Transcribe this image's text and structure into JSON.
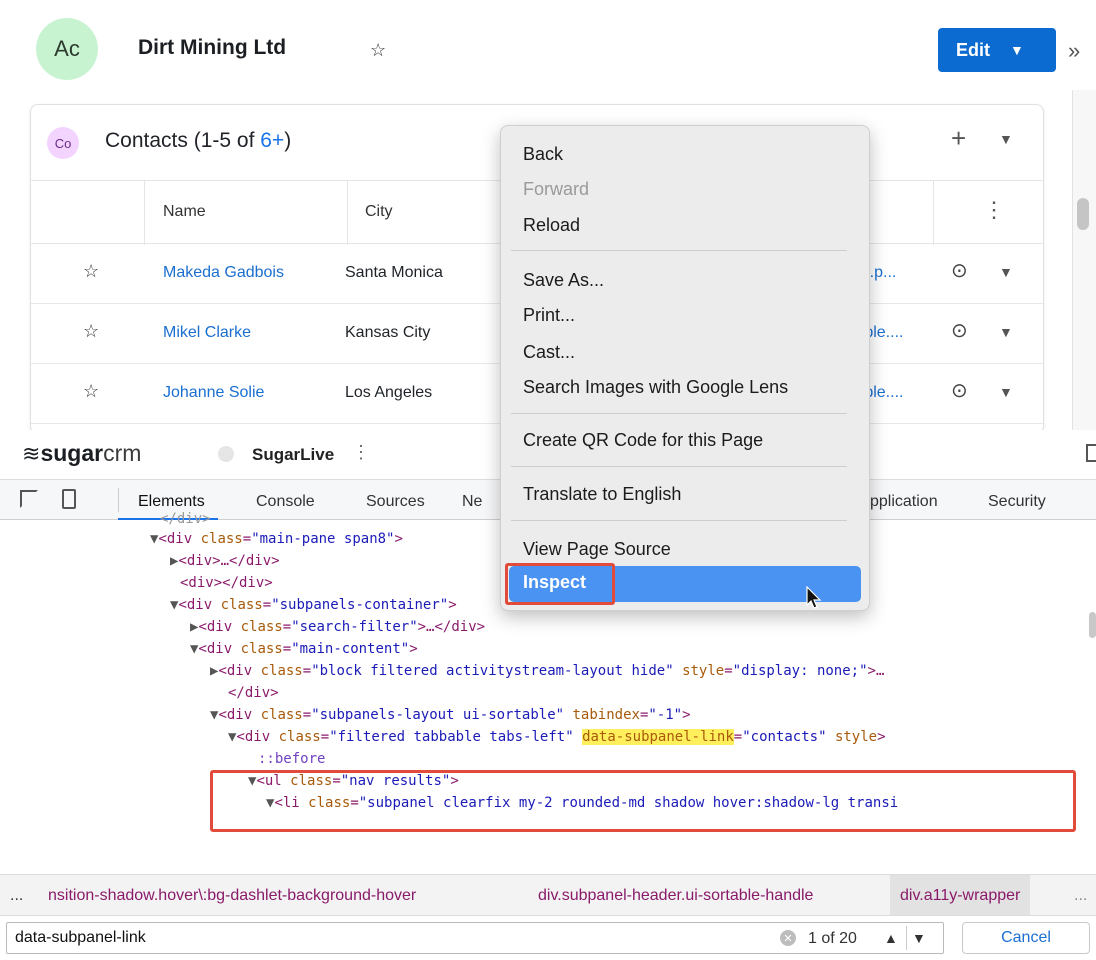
{
  "record": {
    "avatar": "Ac",
    "title": "Dirt Mining Ltd",
    "favorite_icon": "star-outline-icon",
    "edit_label": "Edit"
  },
  "contacts_panel": {
    "badge": "Co",
    "title_prefix": "Contacts (1-5 of ",
    "title_count": "6+",
    "title_suffix": ")",
    "columns": [
      "Name",
      "City"
    ],
    "rows": [
      {
        "name": "Makeda Gadbois",
        "city": "Santa Monica",
        "link": "ort.p..."
      },
      {
        "name": "Mikel Clarke",
        "city": "Kansas City",
        "link": "mple...."
      },
      {
        "name": "Johanne Solie",
        "city": "Los Angeles",
        "link": "mple...."
      }
    ]
  },
  "context_menu": {
    "items": [
      "Back",
      "Forward",
      "Reload",
      "Save As...",
      "Print...",
      "Cast...",
      "Search Images with Google Lens",
      "Create QR Code for this Page",
      "Translate to English",
      "View Page Source",
      "Inspect"
    ],
    "disabled": [
      "Forward"
    ],
    "highlighted": "Inspect"
  },
  "devtools": {
    "brand": {
      "sugar": "sugar",
      "crm": "crm"
    },
    "sugarlive": "SugarLive",
    "tabs": [
      "Elements",
      "Console",
      "Sources",
      "Ne",
      "pplication",
      "Security"
    ],
    "active_tab": "Elements",
    "breadcrumb": {
      "ellipsis_left": "...",
      "item1": "nsition-shadow.hover\\:bg-dashlet-background-hover",
      "item2": "div.subpanel-header.ui-sortable-handle",
      "item3": "div.a11y-wrapper",
      "ellipsis_right": "..."
    },
    "search": {
      "value": "data-subpanel-link",
      "match_count": "1 of 20",
      "cancel_label": "Cancel"
    }
  },
  "colors": {
    "accent": "#0b6bd0",
    "link": "#1a6fd0",
    "highlight_box": "#e04b3c",
    "menu_hover": "#4b93f2",
    "search_highlight": "#ffef5c"
  }
}
